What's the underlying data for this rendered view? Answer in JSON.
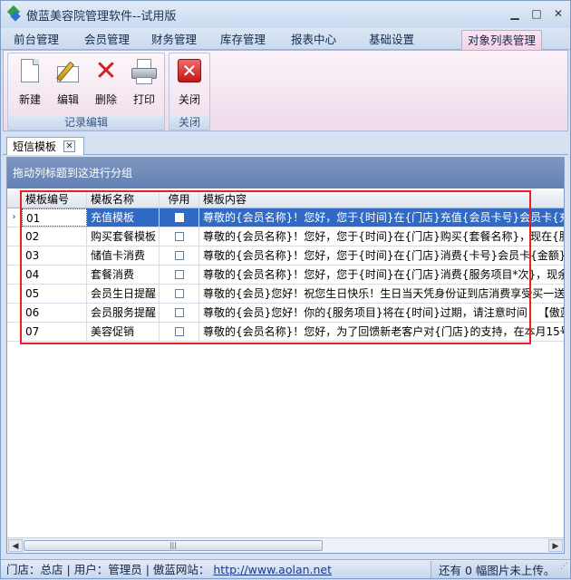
{
  "window": {
    "title": "傲蓝美容院管理软件--试用版"
  },
  "menu": [
    "前台管理",
    "会员管理",
    "财务管理",
    "库存管理",
    "报表中心",
    "基础设置",
    "对象列表管理"
  ],
  "ribbon": {
    "buttons": [
      "新建",
      "编辑",
      "删除",
      "打印"
    ],
    "group1_label": "记录编辑",
    "close_button": "关闭",
    "group2_label": "关闭"
  },
  "doc_tab": {
    "label": "短信模板",
    "close_glyph": "✕"
  },
  "grid": {
    "group_hint": "拖动列标题到这进行分组",
    "columns": [
      "模板编号",
      "模板名称",
      "停用",
      "模板内容"
    ],
    "selected_marker": "›",
    "rows": [
      {
        "id": "01",
        "name": "充值模板",
        "content": "尊敬的{会员名称}！您好，您于{时间}在{门店}充值{会员卡号}会员卡{充值"
      },
      {
        "id": "02",
        "name": "购买套餐模板",
        "content": "尊敬的{会员名称}！您好，您于{时间}在{门店}购买{套餐名称}，现在{服务"
      },
      {
        "id": "03",
        "name": "储值卡消费",
        "content": "尊敬的{会员名称}！您好，您于{时间}在{门店}消费{卡号}会员卡{金额}，剩"
      },
      {
        "id": "04",
        "name": "套餐消费",
        "content": "尊敬的{会员名称}！您好，您于{时间}在{门店}消费{服务项目*次}，现余*次"
      },
      {
        "id": "05",
        "name": "会员生日提醒",
        "content": "尊敬的{会员}您好！祝您生日快乐！生日当天凭身份证到店消费享受买一送一"
      },
      {
        "id": "06",
        "name": "会员服务提醒",
        "content": "尊敬的{会员}您好！你的{服务项目}将在{时间}过期，请注意时间！【傲蓝美"
      },
      {
        "id": "07",
        "name": "美容促销",
        "content": "尊敬的{会员名称}！您好，为了回馈新老客户对{门店}的支持，在本月15号"
      }
    ]
  },
  "statusbar": {
    "store": "门店：总店",
    "user": "用户：管理员",
    "site_label": "傲蓝网站：",
    "site_url": "http://www.aolan.net",
    "upload_status": "还有 0 幅图片未上传。"
  }
}
